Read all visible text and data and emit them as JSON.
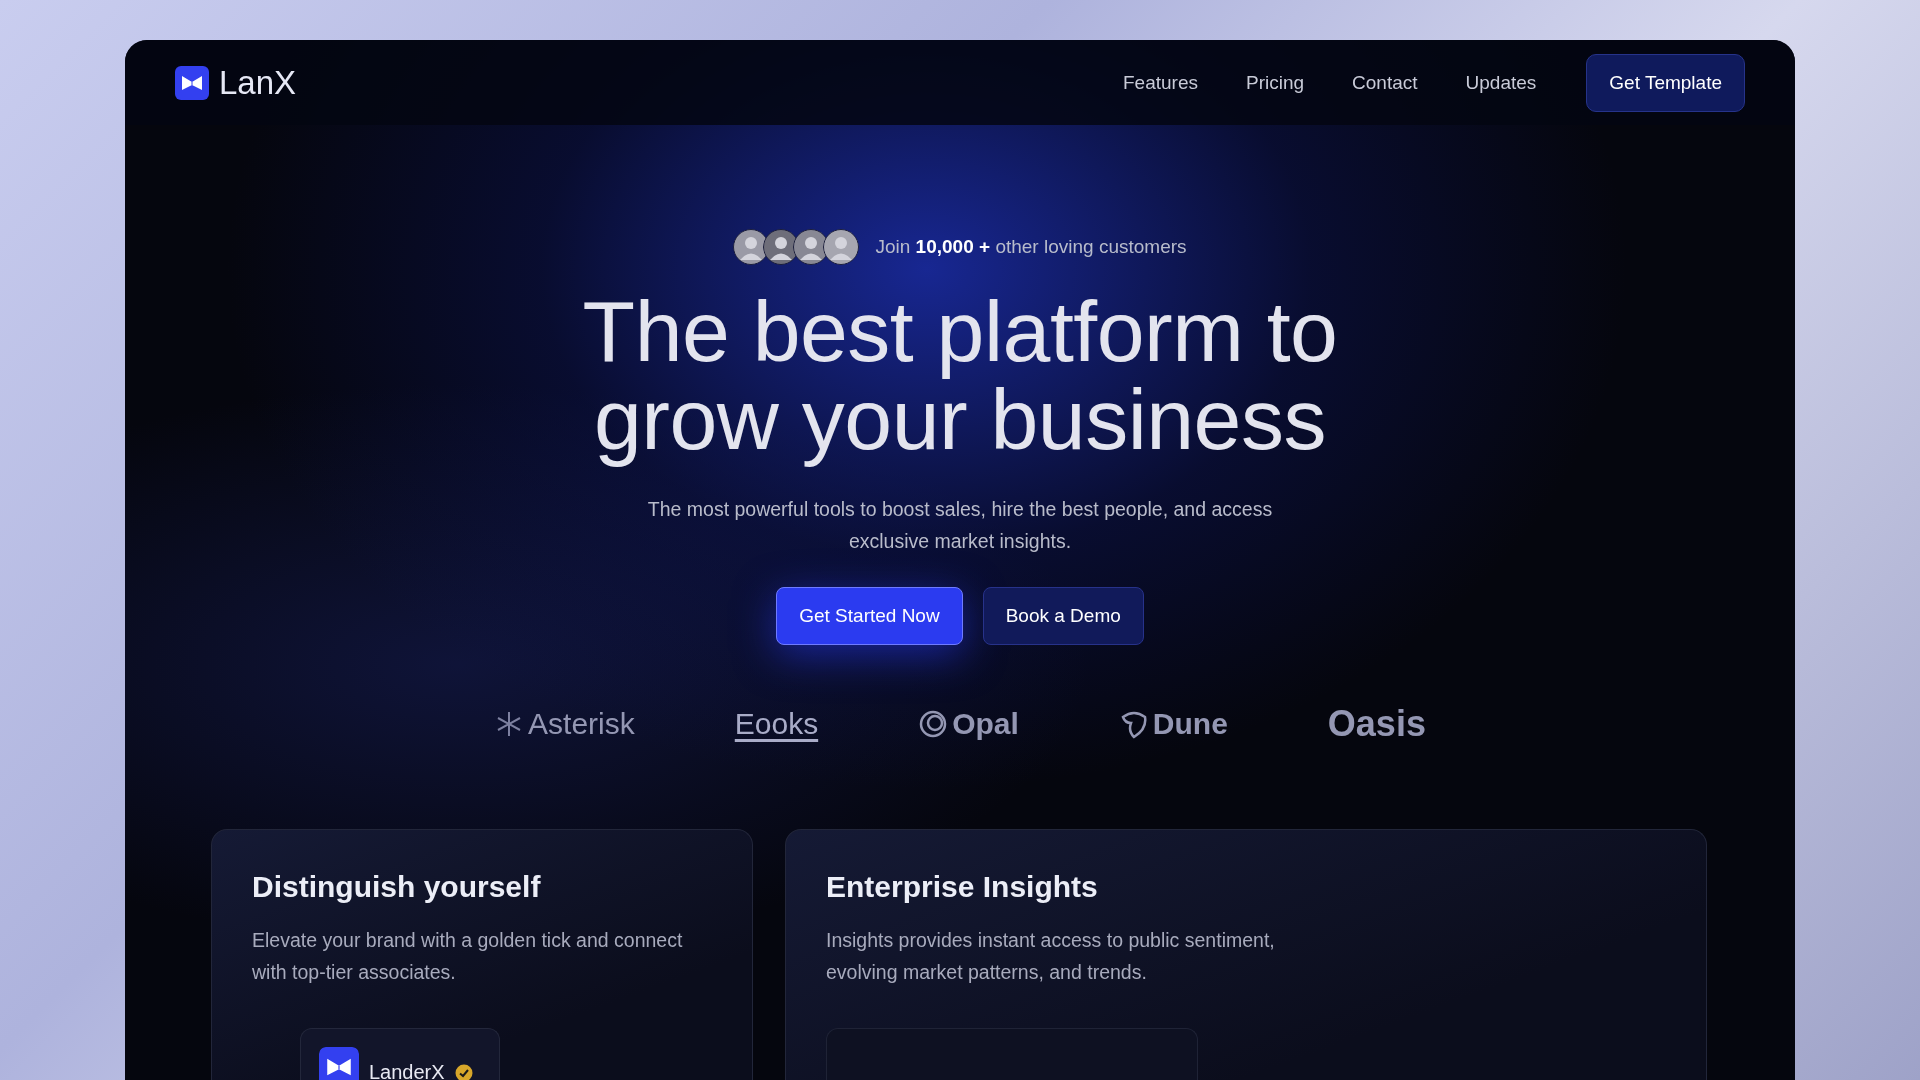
{
  "brand": {
    "name": "LanX"
  },
  "nav": {
    "links": [
      "Features",
      "Pricing",
      "Contact",
      "Updates"
    ],
    "cta": "Get Template"
  },
  "hero": {
    "avatars": [
      {
        "kind": "avatar"
      },
      {
        "kind": "avatar"
      },
      {
        "kind": "avatar"
      },
      {
        "kind": "avatar"
      }
    ],
    "social_proof": "Join **10,000 +** other loving customers",
    "headline": [
      "The best platform to",
      "grow your business"
    ],
    "subtitle": "The most powerful tools to boost sales, hire the best people, and access exclusive market insights.",
    "buttons": [
      {
        "label": "Get Started Now",
        "kind": "primary"
      },
      {
        "label": "Book a Demo",
        "kind": "secondary"
      }
    ]
  },
  "logos": [
    {
      "name": "Asterisk",
      "kind": "asterisk"
    },
    {
      "name": "Eooks",
      "kind": "underlined"
    },
    {
      "name": "Opal",
      "kind": "rings"
    },
    {
      "name": "Dune",
      "kind": "leaf"
    },
    {
      "name": "Oasis",
      "kind": "plain"
    }
  ],
  "cards": [
    {
      "kind": "profile",
      "title": "Distinguish yourself",
      "text": "Elevate your brand with a golden tick and connect with top-tier associates.",
      "profile": {
        "name": "LanderX",
        "verified": true
      }
    },
    {
      "kind": "insights",
      "title": "Enterprise Insights",
      "text": "Insights provides instant access to public sentiment, evolving market patterns, and trends."
    }
  ]
}
